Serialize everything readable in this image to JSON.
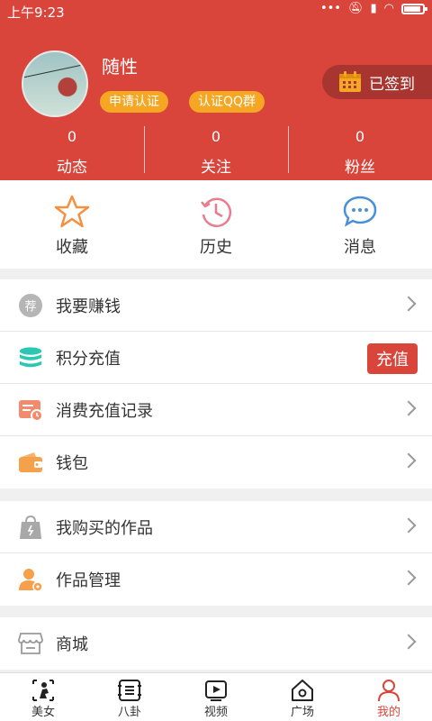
{
  "status_bar": {
    "time": "上午9:23"
  },
  "profile": {
    "username": "随性",
    "badges": [
      "申请认证",
      "认证QQ群"
    ],
    "signin_label": "已签到"
  },
  "stats": [
    {
      "value": "0",
      "label": "动态"
    },
    {
      "value": "0",
      "label": "关注"
    },
    {
      "value": "0",
      "label": "粉丝"
    }
  ],
  "quick_actions": [
    {
      "label": "收藏",
      "icon": "star-icon"
    },
    {
      "label": "历史",
      "icon": "history-icon"
    },
    {
      "label": "消息",
      "icon": "message-icon"
    }
  ],
  "menu_groups": [
    [
      {
        "label": "我要赚钱",
        "icon": "recommend-icon"
      },
      {
        "label": "积分充值",
        "icon": "coins-icon",
        "action_label": "充值"
      },
      {
        "label": "消费充值记录",
        "icon": "record-icon"
      },
      {
        "label": "钱包",
        "icon": "wallet-icon"
      }
    ],
    [
      {
        "label": "我购买的作品",
        "icon": "shopping-bag-icon"
      },
      {
        "label": "作品管理",
        "icon": "user-manage-icon"
      }
    ],
    [
      {
        "label": "商城",
        "icon": "store-icon"
      }
    ]
  ],
  "tabbar": [
    {
      "label": "美女",
      "icon": "beauty-icon"
    },
    {
      "label": "八卦",
      "icon": "gossip-icon"
    },
    {
      "label": "视频",
      "icon": "video-icon"
    },
    {
      "label": "广场",
      "icon": "square-icon"
    },
    {
      "label": "我的",
      "icon": "profile-icon",
      "active": true
    }
  ],
  "colors": {
    "brand": "#d9453b",
    "badge": "#f5a623",
    "signin_bg": "#a93530"
  }
}
